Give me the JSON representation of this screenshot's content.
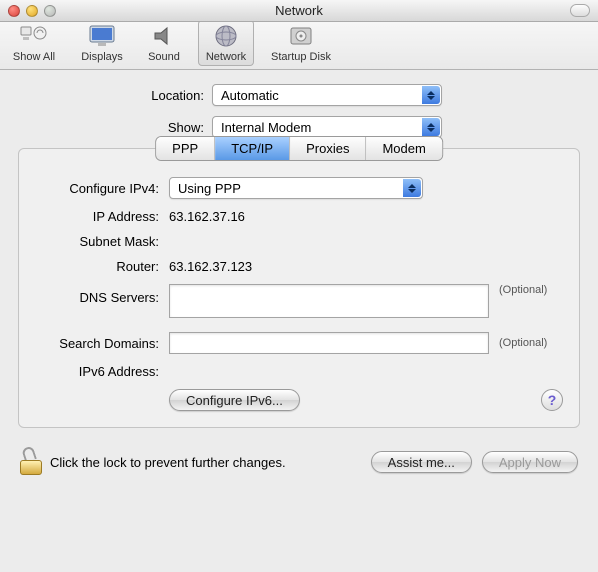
{
  "window": {
    "title": "Network"
  },
  "toolbar": {
    "showAll": "Show All",
    "displays": "Displays",
    "sound": "Sound",
    "network": "Network",
    "startupDisk": "Startup Disk"
  },
  "location": {
    "label": "Location:",
    "value": "Automatic"
  },
  "show": {
    "label": "Show:",
    "value": "Internal Modem"
  },
  "tabs": {
    "ppp": "PPP",
    "tcpip": "TCP/IP",
    "proxies": "Proxies",
    "modem": "Modem"
  },
  "tcpip": {
    "configureLabel": "Configure IPv4:",
    "configureValue": "Using PPP",
    "ipLabel": "IP Address:",
    "ipValue": "63.162.37.16",
    "subnetLabel": "Subnet Mask:",
    "subnetValue": "",
    "routerLabel": "Router:",
    "routerValue": "63.162.37.123",
    "dnsLabel": "DNS Servers:",
    "dnsValue": "",
    "searchLabel": "Search Domains:",
    "searchValue": "",
    "ipv6AddrLabel": "IPv6 Address:",
    "ipv6AddrValue": "",
    "optional": "(Optional)",
    "configureIPv6Btn": "Configure IPv6..."
  },
  "footer": {
    "lockText": "Click the lock to prevent further changes.",
    "assist": "Assist me...",
    "apply": "Apply Now"
  }
}
